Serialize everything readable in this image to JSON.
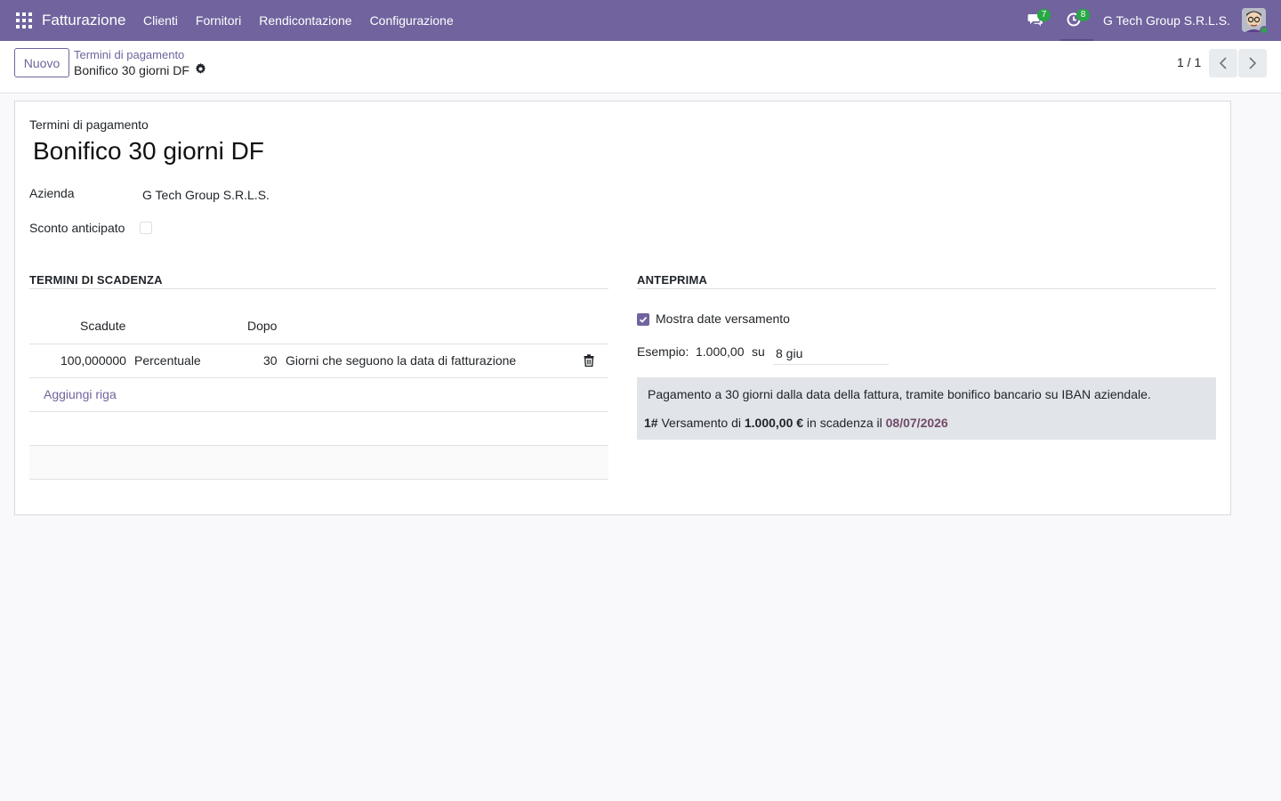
{
  "navbar": {
    "app_name": "Fatturazione",
    "menu": [
      "Clienti",
      "Fornitori",
      "Rendicontazione",
      "Configurazione"
    ],
    "messages_badge": "7",
    "activities_badge": "8",
    "company": "G Tech Group S.R.L.S.",
    "accent_color": "#71639e",
    "badge_color": "#28a745"
  },
  "control_panel": {
    "new_button": "Nuovo",
    "breadcrumb_parent": "Termini di pagamento",
    "breadcrumb_current": "Bonifico 30 giorni DF",
    "pager": "1 / 1"
  },
  "form": {
    "record_type_label": "Termini di pagamento",
    "title": "Bonifico 30 giorni DF",
    "company_label": "Azienda",
    "company_value": "G Tech Group S.R.L.S.",
    "early_discount_label": "Sconto anticipato",
    "early_discount_checked": false
  },
  "terms_section": {
    "title": "TERMINI DI SCADENZA",
    "columns": {
      "due": "Scadute",
      "after": "Dopo"
    },
    "rows": [
      {
        "value": "100,000000",
        "type": "Percentuale",
        "days": "30",
        "condition": "Giorni che seguono la data di fatturazione"
      }
    ],
    "add_line": "Aggiungi riga"
  },
  "preview_section": {
    "title": "ANTEPRIMA",
    "show_dates_label": "Mostra date versamento",
    "show_dates_checked": true,
    "example_label": "Esempio:",
    "example_amount": "1.000,00",
    "example_on": "su",
    "example_date": "8 giu",
    "note": "Pagamento a 30 giorni dalla data della fattura, tramite bonifico bancario su IBAN aziendale.",
    "installment_number": "1#",
    "installment_text_1": "Versamento di",
    "installment_amount": "1.000,00 €",
    "installment_text_2": "in scadenza il",
    "installment_due": "08/07/2026"
  }
}
